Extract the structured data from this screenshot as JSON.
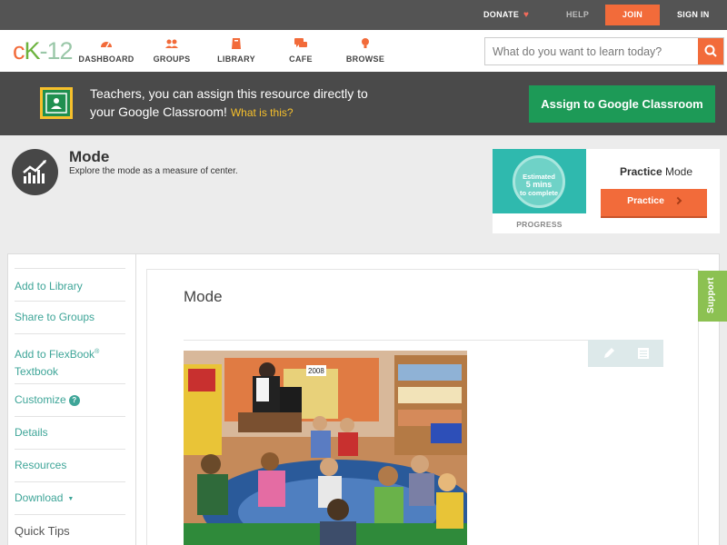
{
  "topbar": {
    "donate": "DONATE",
    "help": "HELP",
    "join": "JOIN",
    "sign_in": "SIGN IN"
  },
  "logo": {
    "text": "cK-12"
  },
  "nav": {
    "items": [
      {
        "label": "DASHBOARD",
        "icon": "dashboard-icon"
      },
      {
        "label": "GROUPS",
        "icon": "groups-icon"
      },
      {
        "label": "LIBRARY",
        "icon": "library-icon"
      },
      {
        "label": "CAFE",
        "icon": "cafe-icon"
      },
      {
        "label": "BROWSE",
        "icon": "browse-icon"
      }
    ],
    "search_placeholder": "What do you want to learn today?"
  },
  "classroom_banner": {
    "line1": "Teachers, you can assign this resource directly to",
    "line2": "your Google Classroom!",
    "link": "What is this?",
    "button": "Assign to Google Classroom"
  },
  "concept": {
    "title": "Mode",
    "description": "Explore the mode as a measure of center."
  },
  "practice_card": {
    "estimate_line1": "Estimated",
    "estimate_line2": "5 mins",
    "estimate_line3": "to complete",
    "progress_label": "PROGRESS",
    "title_bold": "Practice",
    "title_rest": "Mode",
    "button": "Practice"
  },
  "sidebar": {
    "add_to_library": "Add to Library",
    "share_to_groups": "Share to Groups",
    "add_to_flexbook_1": "Add to FlexBook",
    "add_to_flexbook_sup": "®",
    "add_to_flexbook_2": "Textbook",
    "customize": "Customize",
    "customize_help": "?",
    "details": "Details",
    "resources": "Resources",
    "download": "Download",
    "quick_tips": "Quick Tips"
  },
  "content": {
    "title": "Mode",
    "photo_sign": "2008"
  },
  "support": {
    "label": "Support"
  },
  "colors": {
    "accent_orange": "#f26b3a",
    "teal_link": "#3ea598",
    "google_green": "#1d9a57",
    "support_green": "#8cc152"
  }
}
